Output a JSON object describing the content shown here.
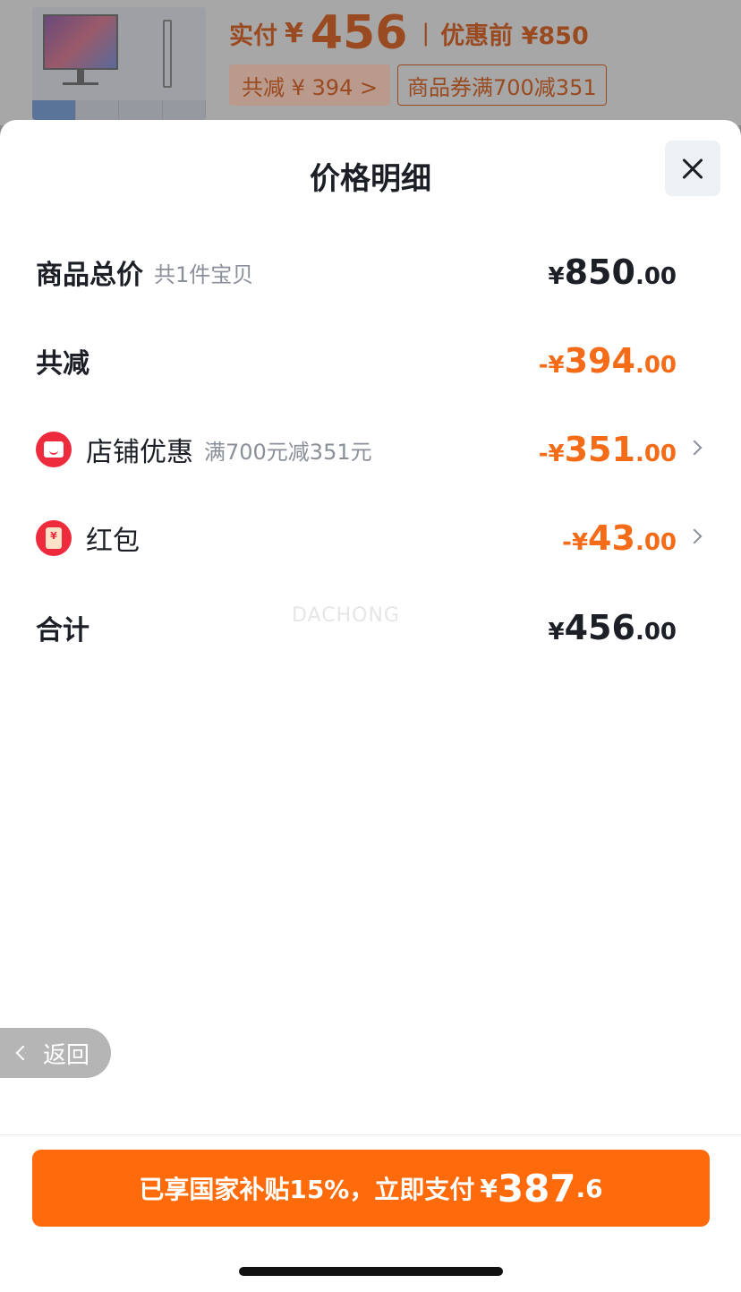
{
  "background": {
    "pay_label": "实付",
    "yen": "¥",
    "pay_amount": "456",
    "divider": "|",
    "before_label": "优惠前 ¥850",
    "chip_reduce": "共减 ¥ 394 >",
    "chip_coupon": "商品券满700减351"
  },
  "sheet": {
    "title": "价格明细",
    "rows": {
      "total": {
        "label": "商品总价",
        "sub": "共1件宝贝",
        "sign": "¥",
        "int": "850",
        "dec": ".00"
      },
      "reduce": {
        "label": "共减",
        "sign": "-¥",
        "int": "394",
        "dec": ".00"
      },
      "shop": {
        "label": "店铺优惠",
        "sub": "满700元减351元",
        "sign": "-¥",
        "int": "351",
        "dec": ".00"
      },
      "redpacket": {
        "label": "红包",
        "sign": "-¥",
        "int": "43",
        "dec": ".00"
      },
      "sum": {
        "label": "合计",
        "sign": "¥",
        "int": "456",
        "dec": ".00"
      }
    },
    "watermark": "DACHONG",
    "back_label": "返回",
    "pay_button": {
      "text": "已享国家补贴15%，立即支付",
      "yen": "¥",
      "int": "387",
      "dec": ".6"
    }
  },
  "colors": {
    "accent": "#ff6a0a",
    "discount": "#f46b18",
    "badge": "#ee2a3d"
  },
  "icons": [
    "close-icon",
    "store-icon",
    "red-packet-icon",
    "chevron-right-icon",
    "back-arrow-icon"
  ]
}
